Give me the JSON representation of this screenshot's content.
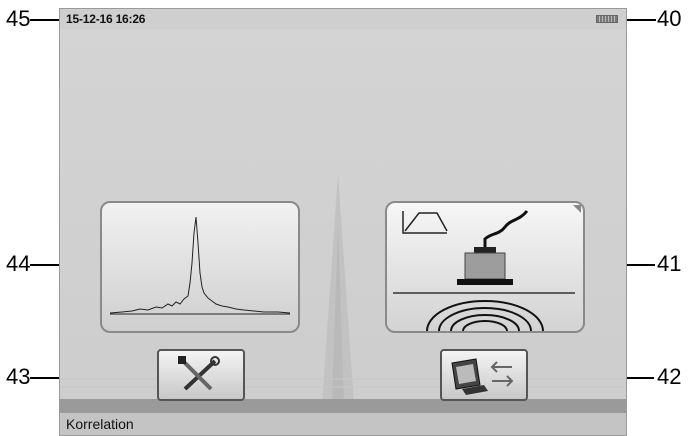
{
  "status": {
    "datetime": "15-12-16 16:26"
  },
  "footer": {
    "label": "Korrelation"
  },
  "callouts": {
    "c40": "40",
    "c41": "41",
    "c42": "42",
    "c43": "43",
    "c44": "44",
    "c45": "45"
  },
  "icons": {
    "correlation_tile": "correlation-spectrum-icon",
    "sensor_tile": "ground-sensor-icon",
    "tools_button": "tools-icon",
    "transfer_button": "data-transfer-icon",
    "battery": "battery-icon"
  }
}
